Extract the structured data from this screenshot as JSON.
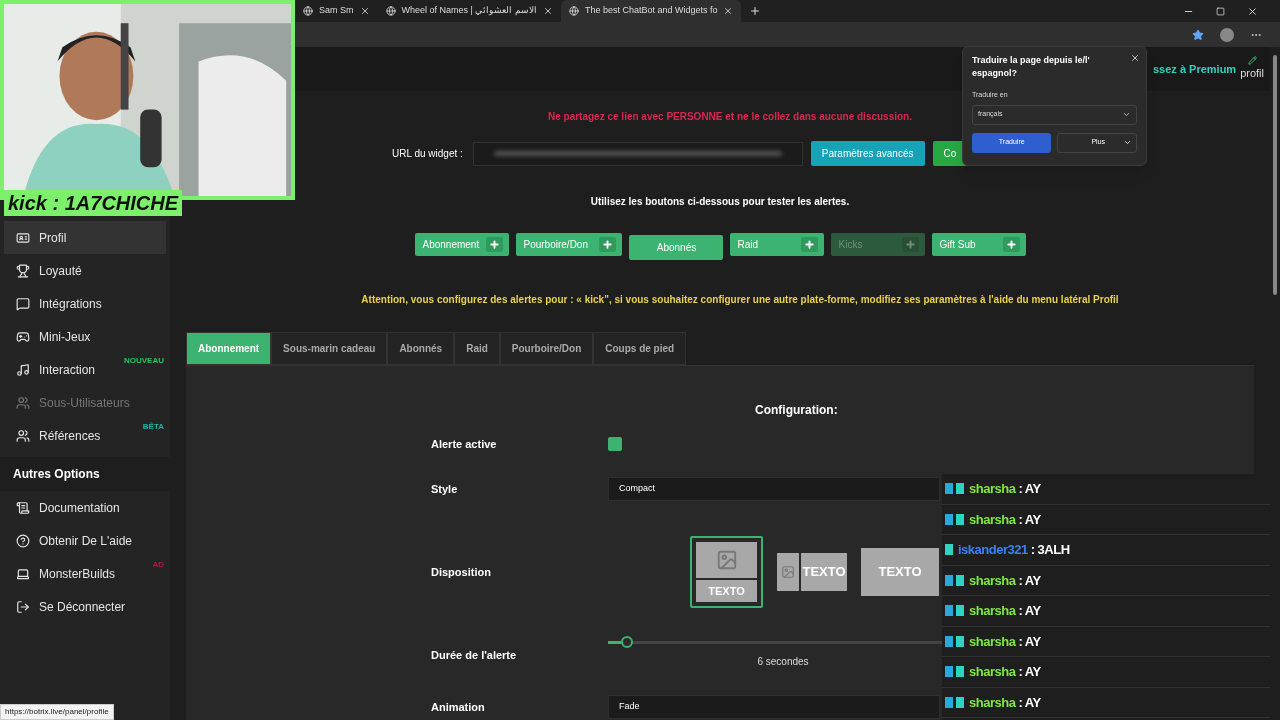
{
  "browser": {
    "tabs": [
      {
        "title": "Sam Sm",
        "selected": false
      },
      {
        "title": "Wheel of Names | الاسم العشوائي",
        "selected": false
      },
      {
        "title": "The best ChatBot and Widgets fo",
        "selected": true
      }
    ]
  },
  "translate_popup": {
    "title": "Traduire la page depuis le/l' espagnol?",
    "label": "Traduire en",
    "language": "français",
    "primary": "Traduire",
    "secondary": "Plus"
  },
  "header": {
    "premium": "ssez à Premium",
    "profile": "profil"
  },
  "sidebar": {
    "items": [
      {
        "kind": "item",
        "label": "Profil",
        "selected": true,
        "disabled": false
      },
      {
        "kind": "item",
        "label": "Loyauté",
        "selected": false,
        "disabled": false
      },
      {
        "kind": "item",
        "label": "Intégrations",
        "selected": false,
        "disabled": false
      },
      {
        "kind": "item",
        "label": "Mini-Jeux",
        "selected": false,
        "disabled": false
      },
      {
        "kind": "item",
        "label": "Interaction",
        "badge": "NOUVEAU",
        "color": "#22c55e",
        "selected": false,
        "disabled": false
      },
      {
        "kind": "item",
        "label": "Sous-Utilisateurs",
        "selected": false,
        "disabled": true
      },
      {
        "kind": "item",
        "label": "Références",
        "badge": "BÊTA",
        "color": "#14b8a6",
        "selected": false,
        "disabled": false
      },
      {
        "kind": "heading",
        "label": "Autres Options"
      },
      {
        "kind": "item",
        "label": "Documentation",
        "selected": false,
        "disabled": false
      },
      {
        "kind": "item",
        "label": "Obtenir De L'aide",
        "selected": false,
        "disabled": false
      },
      {
        "kind": "item",
        "label": "MonsterBuilds",
        "badge": "AD",
        "color": "#be123c",
        "selected": false,
        "disabled": false
      },
      {
        "kind": "item",
        "label": "Se Déconnecter",
        "selected": false,
        "disabled": false
      }
    ]
  },
  "widget": {
    "warning": "Ne partagez ce lien avec PERSONNE et ne le collez dans aucune discussion.",
    "url_label": "URL du widget :",
    "buttons": [
      {
        "label": "Paramètres avancés",
        "color": "#17a2b8"
      },
      {
        "label": "Co",
        "color": "#28a745"
      }
    ]
  },
  "test": {
    "instruction": "Utilisez les boutons ci-dessous pour tester les alertes.",
    "buttons": [
      {
        "label": "Abonnement",
        "plus": true,
        "disabled": false
      },
      {
        "label": "Pourboire/Don",
        "plus": true,
        "disabled": false
      },
      {
        "label": "Abonnés",
        "plus": false,
        "disabled": false
      },
      {
        "label": "Raid",
        "plus": true,
        "disabled": false
      },
      {
        "label": "Kicks",
        "plus": true,
        "disabled": true
      },
      {
        "label": "Gift Sub",
        "plus": true,
        "disabled": false
      }
    ],
    "attention": "Attention, vous configurez des alertes pour : « **kick**\", si vous souhaitez configurer une autre plate-forme, modifiez ses paramètres à l'aide du menu latéral Profil"
  },
  "tabs": [
    {
      "label": "Abonnement",
      "selected": true
    },
    {
      "label": "Sous-marin cadeau",
      "selected": false
    },
    {
      "label": "Abonnés",
      "selected": false
    },
    {
      "label": "Raid",
      "selected": false
    },
    {
      "label": "Pourboire/Don",
      "selected": false
    },
    {
      "label": "Coups de pied",
      "selected": false
    }
  ],
  "config": {
    "title": "Configuration:",
    "rows": [
      {
        "kind": "checkbox",
        "label": "Alerte active",
        "checked": true
      },
      {
        "kind": "select",
        "label": "Style",
        "value": "Compact"
      },
      {
        "kind": "layout",
        "label": "Disposition",
        "options": [
          {
            "text": "TEXTO",
            "selected": true
          },
          {
            "text": "TEXTO",
            "selected": false
          },
          {
            "text": "TEXTO",
            "selected": false
          }
        ]
      },
      {
        "kind": "slider",
        "label": "Durée de l'alerte",
        "level": 0.05,
        "reading": "6 secondes"
      },
      {
        "kind": "select",
        "label": "Animation",
        "value": "Fade"
      }
    ]
  },
  "chat": {
    "messages": [
      {
        "kind": "double",
        "user": "sharsha",
        "text": ": AY",
        "color": "#7ee83f"
      },
      {
        "kind": "double",
        "user": "sharsha",
        "text": ": AY",
        "color": "#7ee83f"
      },
      {
        "kind": "single",
        "user": "iskander321",
        "text": ": 3ALH",
        "color": "#3b82f6"
      },
      {
        "kind": "double",
        "user": "sharsha",
        "text": ": AY",
        "color": "#7ee83f"
      },
      {
        "kind": "double",
        "user": "sharsha",
        "text": ": AY",
        "color": "#7ee83f"
      },
      {
        "kind": "double",
        "user": "sharsha",
        "text": ": AY",
        "color": "#7ee83f"
      },
      {
        "kind": "double",
        "user": "sharsha",
        "text": ": AY",
        "color": "#7ee83f"
      },
      {
        "kind": "double",
        "user": "sharsha",
        "text": ": AY",
        "color": "#7ee83f"
      }
    ]
  },
  "overlay": {
    "handle": "kick : 1A7CHICHE"
  },
  "status_bar": {
    "url": "https://botrix.live/panel/profile"
  }
}
